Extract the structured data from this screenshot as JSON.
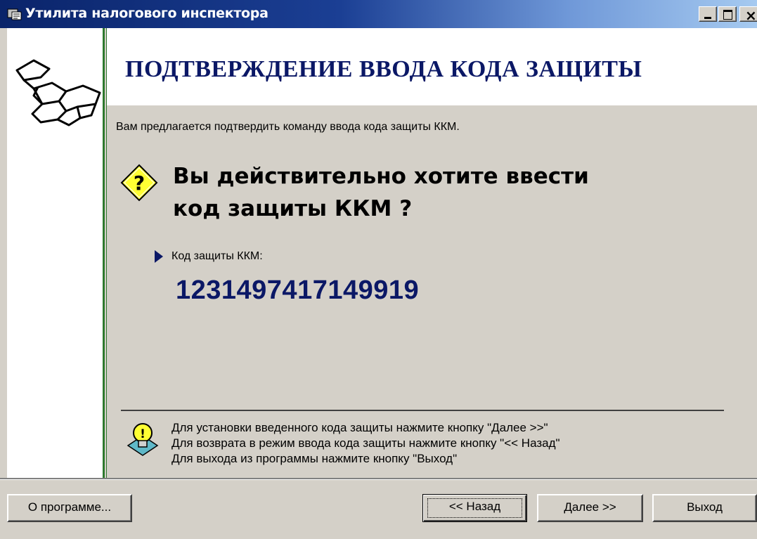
{
  "window": {
    "title": "Утилита налогового инспектора",
    "controls": [
      "minimize",
      "maximize",
      "close"
    ]
  },
  "header": {
    "title": "ПОДТВЕРЖДЕНИЕ  ВВОДА  КОДА ЗАЩИТЫ"
  },
  "main": {
    "intro": "Вам предлагается подтвердить команду  ввода кода защиты ККМ.",
    "question_line1": "Вы действительно хотите ввести",
    "question_line2": "код защиты ККМ ?",
    "code_label": "Код защиты ККМ:",
    "code_value": "1231497417149919"
  },
  "hints": {
    "line1": "Для установки введенного кода защиты нажмите кнопку \"Далее >>\"",
    "line2": "Для возврата в режим  ввода  кода защиты нажмите кнопку \"<< Назад\"",
    "line3": "Для выхода из программы нажмите кнопку \"Выход\""
  },
  "buttons": {
    "about": "О программе...",
    "back": "<< Назад",
    "next": "Далее >>",
    "exit": "Выход"
  },
  "colors": {
    "titlebar_start": "#0a246a",
    "titlebar_end": "#a6caf0",
    "heading": "#0b1866",
    "face": "#d4d0c8",
    "panel_divider": "#2f7a2f"
  },
  "icons": {
    "app": "app-icon",
    "logo": "cubes-logo",
    "question": "question-diamond-icon",
    "bullet": "bullet-arrow-icon",
    "hint": "lightbulb-icon"
  }
}
